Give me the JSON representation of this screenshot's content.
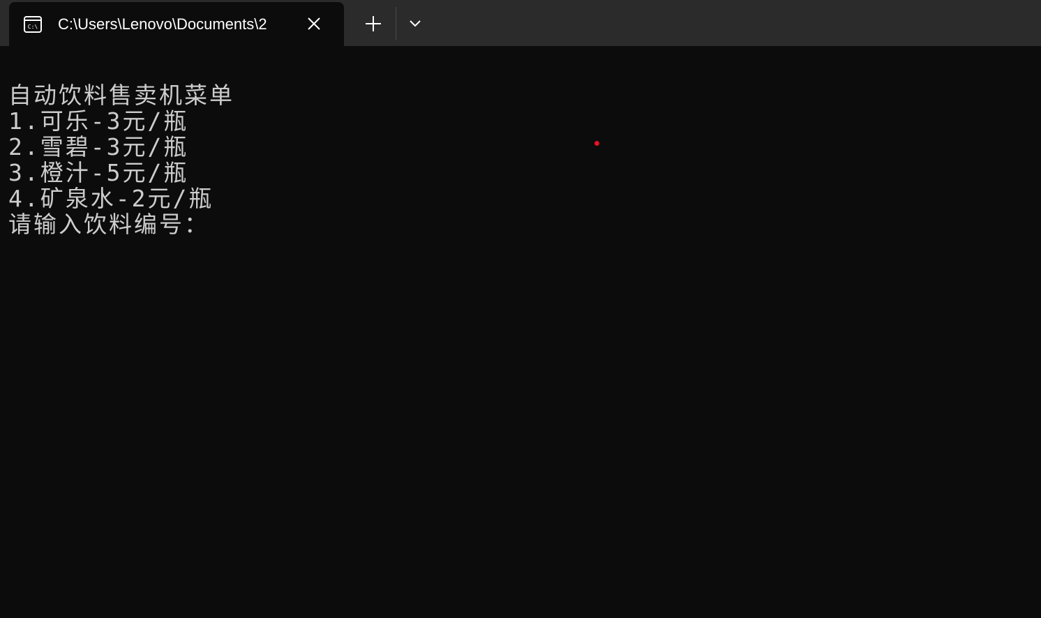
{
  "window": {
    "tab_title": "C:\\Users\\Lenovo\\Documents\\2",
    "icons": {
      "tab": "terminal-icon",
      "close": "close-icon",
      "new_tab": "plus-icon",
      "dropdown": "chevron-down-icon"
    }
  },
  "console": {
    "lines": [
      "自动饮料售卖机菜单",
      "1.可乐-3元/瓶",
      "2.雪碧-3元/瓶",
      "3.橙汁-5元/瓶",
      "4.矿泉水-2元/瓶",
      "请输入饮料编号："
    ]
  },
  "colors": {
    "background": "#0c0c0c",
    "titlebar": "#2b2b2b",
    "text": "#cccccc",
    "cursor": "#e81123"
  }
}
